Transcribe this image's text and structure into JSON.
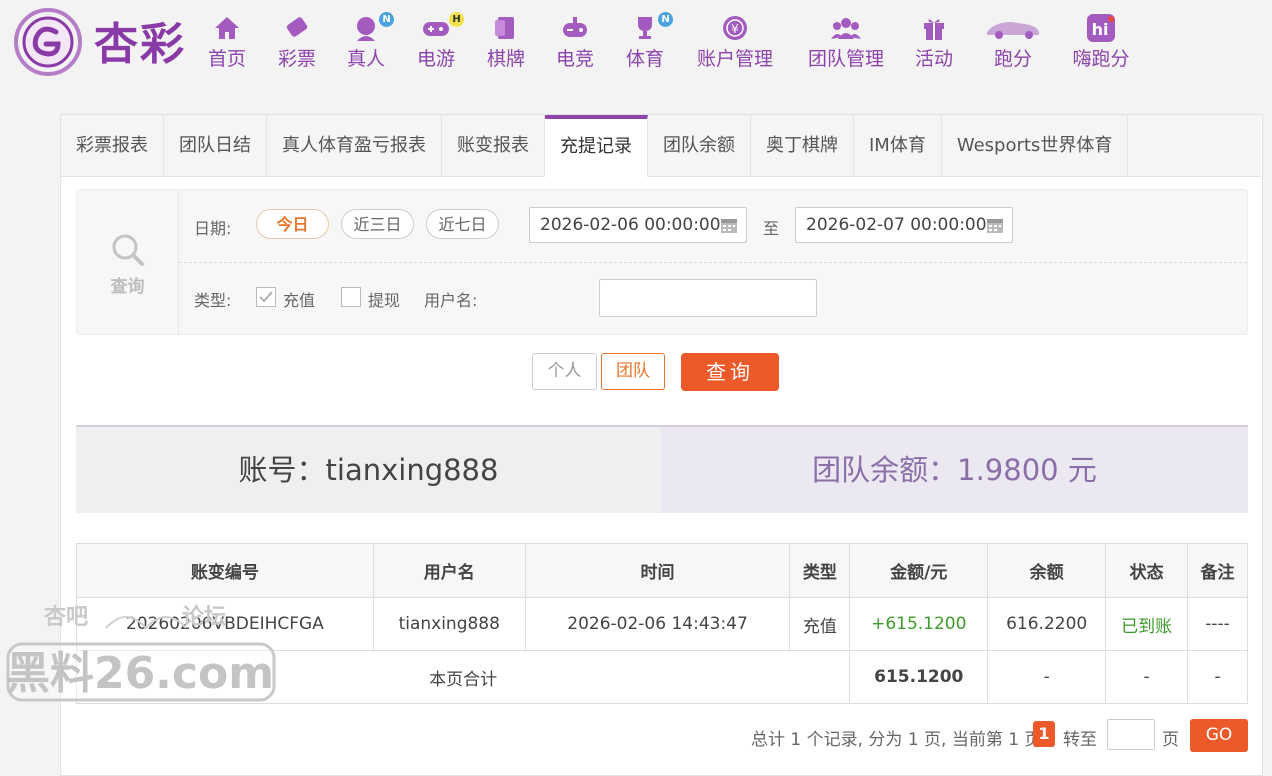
{
  "brand": {
    "logo_text": "杏彩"
  },
  "nav": [
    {
      "label": "首页",
      "icon": "home-icon",
      "badge": ""
    },
    {
      "label": "彩票",
      "icon": "lottery-ticket-icon",
      "badge": ""
    },
    {
      "label": "真人",
      "icon": "live-dealer-icon",
      "badge": "N"
    },
    {
      "label": "电游",
      "icon": "gamepad-icon",
      "badge": "H"
    },
    {
      "label": "棋牌",
      "icon": "cards-icon",
      "badge": ""
    },
    {
      "label": "电竞",
      "icon": "esports-controller-icon",
      "badge": ""
    },
    {
      "label": "体育",
      "icon": "trophy-icon",
      "badge": "N"
    },
    {
      "label": "账户管理",
      "icon": "yen-coin-icon",
      "badge": ""
    },
    {
      "label": "团队管理",
      "icon": "team-icon",
      "badge": ""
    },
    {
      "label": "活动",
      "icon": "gift-icon",
      "badge": ""
    },
    {
      "label": "跑分",
      "icon": "sports-car-icon",
      "badge": ""
    },
    {
      "label": "嗨跑分",
      "icon": "hi-app-icon",
      "badge": ""
    }
  ],
  "tabs": [
    "彩票报表",
    "团队日结",
    "真人体育盈亏报表",
    "账变报表",
    "充提记录",
    "团队余额",
    "奥丁棋牌",
    "IM体育",
    "Wesports世界体育"
  ],
  "active_tab": "充提记录",
  "query": {
    "side_label": "查询",
    "date_label": "日期:",
    "quick_dates": [
      "今日",
      "近三日",
      "近七日"
    ],
    "active_quick_date": "今日",
    "start": "2026-02-06 00:00:00",
    "to": "至",
    "end": "2026-02-07 00:00:00",
    "type_label": "类型:",
    "types": [
      {
        "label": "充值",
        "checked": true
      },
      {
        "label": "提现",
        "checked": false
      }
    ],
    "username_label": "用户名:",
    "username_value": ""
  },
  "buttons": {
    "personal": "个人",
    "team": "团队",
    "search": "查询"
  },
  "summary": {
    "account": "账号：tianxing888",
    "team_balance": "团队余额：1.9800 元"
  },
  "table": {
    "headers": [
      "账变编号",
      "用户名",
      "时间",
      "类型",
      "金额/元",
      "余额",
      "状态",
      "备注"
    ],
    "rows": [
      [
        "20260206VBDEIHCFGA",
        "tianxing888",
        "2026-02-06 14:43:47",
        "充值",
        "+615.1200",
        "616.2200",
        "已到账",
        "----"
      ]
    ],
    "total": {
      "label": "本页合计",
      "amount": "615.1200",
      "balance": "-",
      "status": "-",
      "note": "-"
    }
  },
  "pager": {
    "summary": "总计 1 个记录, 分为 1 页, 当前第 1 页",
    "current": "1",
    "goto_label": "转至",
    "page_label": "页",
    "go": "GO"
  },
  "watermark": {
    "line1": "杏吧论坛",
    "line2": "黑料26.com"
  },
  "colors": {
    "brand_purple": "#8e44ad",
    "accent_orange": "#ec5a2a",
    "success_green": "#3d9a2b"
  }
}
